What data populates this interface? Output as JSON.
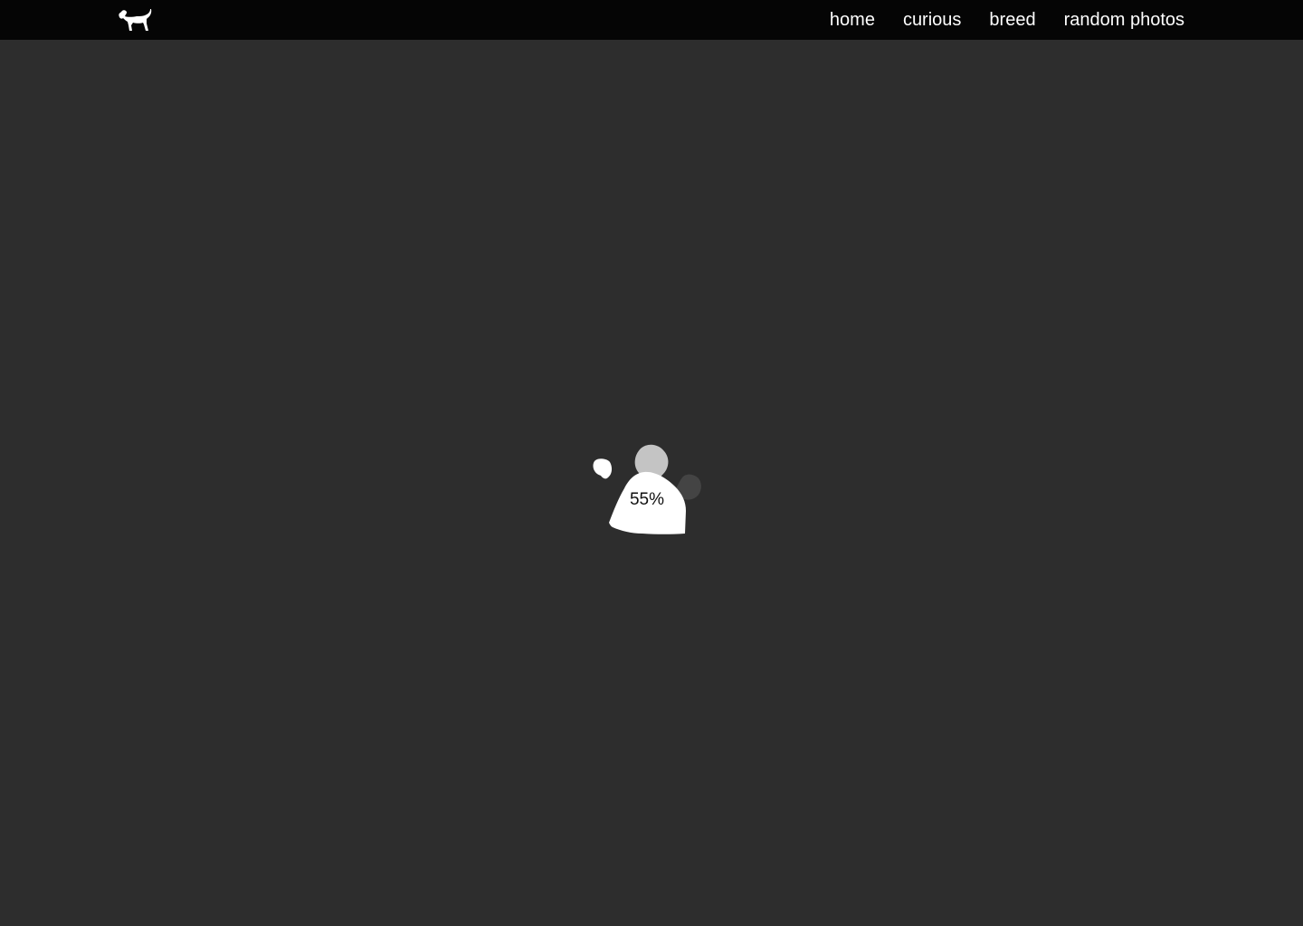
{
  "header": {
    "logo_icon": "dog-silhouette-icon",
    "nav": [
      {
        "label": "home"
      },
      {
        "label": "curious"
      },
      {
        "label": "breed"
      },
      {
        "label": "random photos"
      }
    ]
  },
  "loader": {
    "icon": "paw-print-icon",
    "progress_text": "55%",
    "progress_value": 55,
    "colors": {
      "page_background": "#2d2d2d",
      "navbar_background": "#050505",
      "paw_active": "#ffffff",
      "paw_mid": "#c4c4c4",
      "paw_dim": "#444444",
      "label_text": "#111111"
    }
  }
}
